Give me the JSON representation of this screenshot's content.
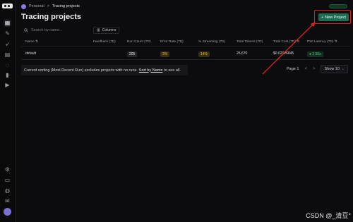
{
  "breadcrumb": {
    "workspace": "Personal",
    "separator": ">",
    "current": "Tracing projects"
  },
  "top_badge": "·",
  "page": {
    "title": "Tracing projects",
    "new_button_label": "New Project",
    "new_button_icon": "+"
  },
  "toolbar": {
    "search_placeholder": "Search by name...",
    "columns_label": "Columns"
  },
  "table": {
    "columns": [
      "Name",
      "Feedback (7D)",
      "Run Count (7D)",
      "Error Rate (7D)",
      "% Streaming (7D)",
      "Total Tokens (7D)",
      "Total Cost (7D)",
      "P50 Latency (7D)"
    ],
    "rows": [
      {
        "name": "default",
        "feedback": "",
        "run_count": "205",
        "error_rate": "3%",
        "streaming": "14%",
        "total_tokens": "26,670",
        "total_cost": "$0.02026845",
        "p50_latency": "2.50s"
      }
    ]
  },
  "note": {
    "prefix": "Current sorting (Most Recent Run) excludes projects with no runs.",
    "link": "Sort by Name",
    "suffix": "to see all."
  },
  "pagination": {
    "page_label": "Page 1",
    "prev": "<",
    "next": ">",
    "show_label": "Show 10"
  },
  "watermark": "CSDN @_清豆°",
  "colors": {
    "accent": "#1e6b56",
    "highlight": "#e2231a",
    "background": "#0c0c0e"
  },
  "sidebar_icons": [
    "grid-icon",
    "edit-icon",
    "rocket-icon",
    "database-icon",
    "chat-icon",
    "chart-icon",
    "play-icon",
    "settings-icon",
    "document-icon",
    "globe-icon",
    "mail-icon",
    "user-avatar"
  ]
}
